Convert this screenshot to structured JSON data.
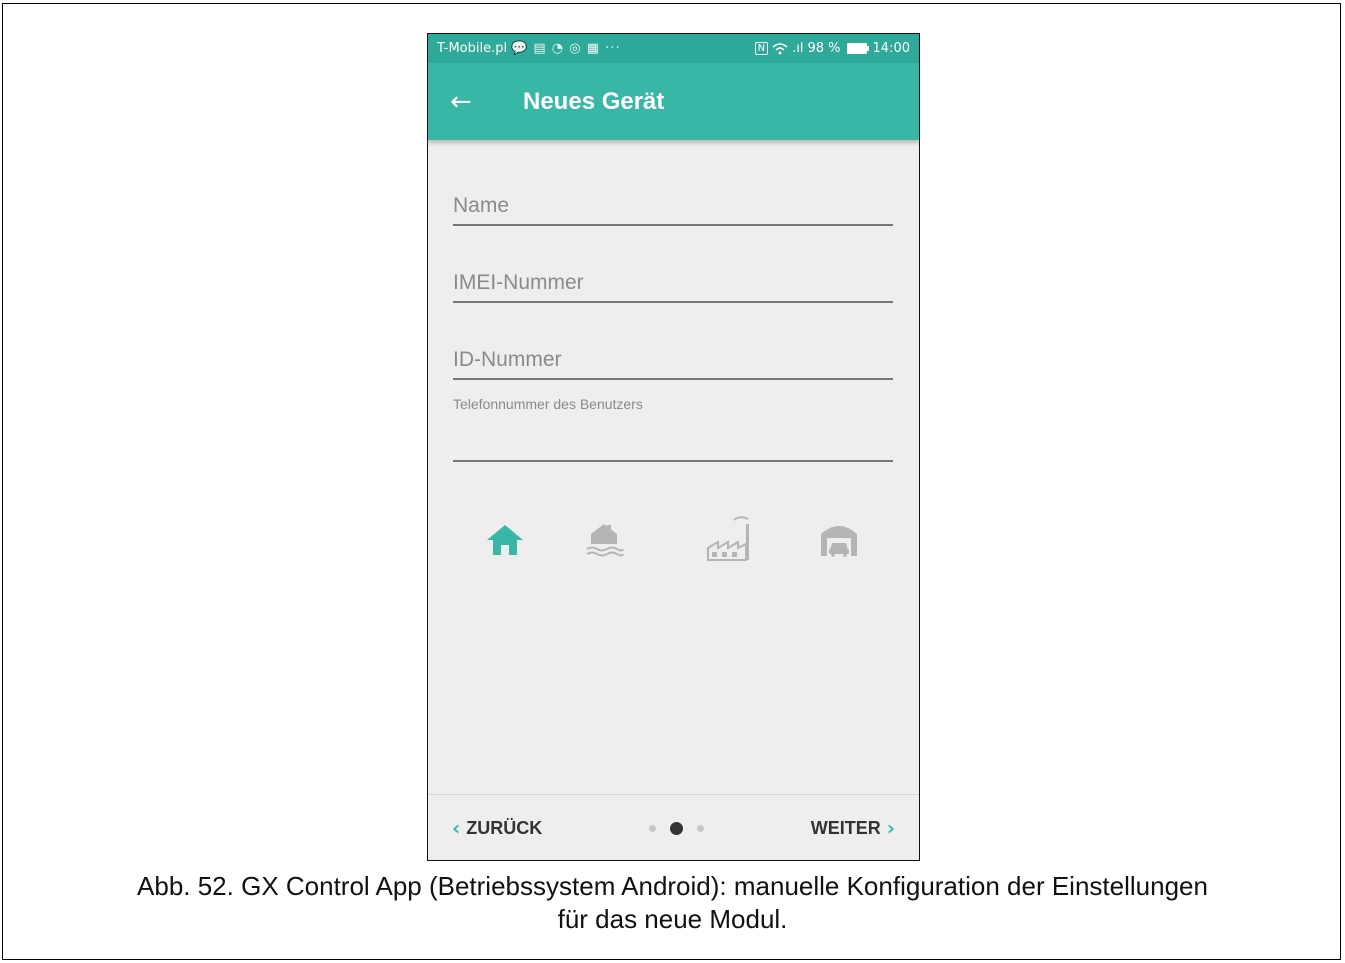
{
  "status_bar": {
    "carrier": "T-Mobile.pl",
    "notification_icons": "💬 ▤ ◔ ◎ ▦ ···",
    "nfc": "N",
    "signal": ".ıl",
    "battery_percent": "98 %",
    "time": "14:00"
  },
  "app_bar": {
    "title": "Neues Gerät"
  },
  "form": {
    "name_placeholder": "Name",
    "imei_placeholder": "IMEI-Nummer",
    "id_placeholder": "ID-Nummer",
    "phone_label": "Telefonnummer des Benutzers",
    "phone_value": ""
  },
  "device_types": [
    {
      "icon": "house-icon",
      "selected": true
    },
    {
      "icon": "house-by-water-icon",
      "selected": false
    },
    {
      "icon": "factory-icon",
      "selected": false
    },
    {
      "icon": "garage-icon",
      "selected": false
    }
  ],
  "navigation": {
    "back_label": "ZURÜCK",
    "next_label": "WEITER",
    "back_chevron": "‹",
    "next_chevron": "›",
    "page_count": 3,
    "current_page": 2
  },
  "colors": {
    "accent": "#38b7a6",
    "status_bar": "#2ea99a",
    "inactive_icon": "#b5b5b5"
  },
  "caption": {
    "line1": "Abb. 52. GX Control App (Betriebssystem Android): manuelle Konfiguration der Einstellungen",
    "line2": "für das neue Modul."
  }
}
